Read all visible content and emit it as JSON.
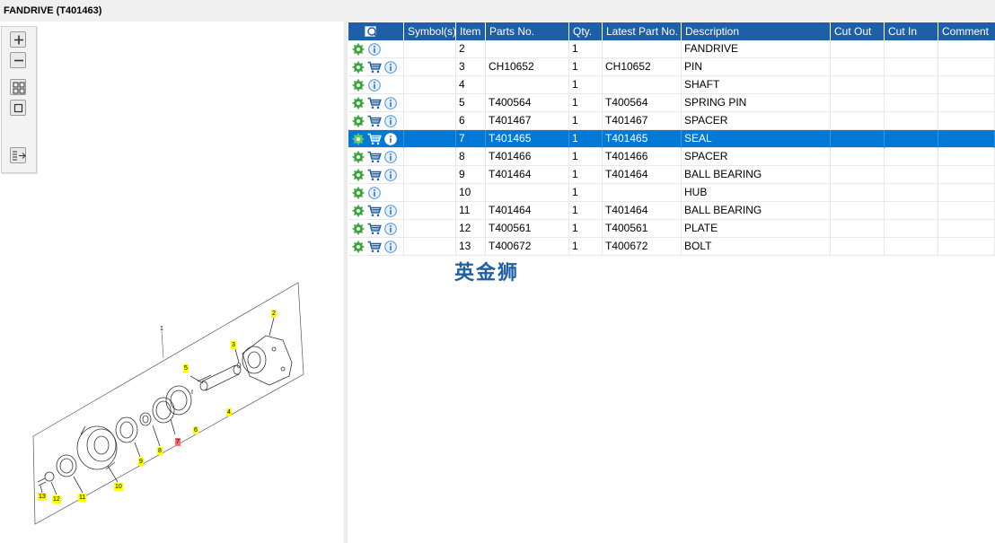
{
  "window": {
    "title": "FANDRIVE (T401463)"
  },
  "toolbar": {
    "buttons": [
      {
        "name": "zoom-in",
        "icon": "plus-icon"
      },
      {
        "name": "zoom-out",
        "icon": "minus-icon"
      },
      {
        "name": "fit-all",
        "icon": "fit-all-icon"
      },
      {
        "name": "fit-window",
        "icon": "fit-window-icon"
      },
      {
        "name": "export",
        "icon": "export-icon"
      }
    ]
  },
  "diagram": {
    "callouts": [
      {
        "label": "1",
        "style": "plain"
      },
      {
        "label": "2",
        "style": "yellow"
      },
      {
        "label": "3",
        "style": "yellow"
      },
      {
        "label": "4",
        "style": "yellow"
      },
      {
        "label": "5",
        "style": "yellow"
      },
      {
        "label": "6",
        "style": "yellow"
      },
      {
        "label": "7",
        "style": "red"
      },
      {
        "label": "8",
        "style": "yellow"
      },
      {
        "label": "9",
        "style": "yellow"
      },
      {
        "label": "10",
        "style": "yellow"
      },
      {
        "label": "11",
        "style": "yellow"
      },
      {
        "label": "12",
        "style": "yellow"
      },
      {
        "label": "13",
        "style": "yellow"
      }
    ]
  },
  "grid": {
    "header_icon": "search-icon",
    "columns": [
      "Symbol(s)",
      "Item",
      "Parts No.",
      "Qty.",
      "Latest Part No.",
      "Description",
      "Cut Out",
      "Cut In",
      "Comment"
    ],
    "rows": [
      {
        "item": "2",
        "parts_no": "",
        "qty": "1",
        "latest": "",
        "desc": "FANDRIVE",
        "cart": false,
        "selected": false
      },
      {
        "item": "3",
        "parts_no": "CH10652",
        "qty": "1",
        "latest": "CH10652",
        "desc": "PIN",
        "cart": true,
        "selected": false
      },
      {
        "item": "4",
        "parts_no": "",
        "qty": "1",
        "latest": "",
        "desc": "SHAFT",
        "cart": false,
        "selected": false
      },
      {
        "item": "5",
        "parts_no": "T400564",
        "qty": "1",
        "latest": "T400564",
        "desc": "SPRING PIN",
        "cart": true,
        "selected": false
      },
      {
        "item": "6",
        "parts_no": "T401467",
        "qty": "1",
        "latest": "T401467",
        "desc": "SPACER",
        "cart": true,
        "selected": false
      },
      {
        "item": "7",
        "parts_no": "T401465",
        "qty": "1",
        "latest": "T401465",
        "desc": "SEAL",
        "cart": true,
        "selected": true
      },
      {
        "item": "8",
        "parts_no": "T401466",
        "qty": "1",
        "latest": "T401466",
        "desc": "SPACER",
        "cart": true,
        "selected": false
      },
      {
        "item": "9",
        "parts_no": "T401464",
        "qty": "1",
        "latest": "T401464",
        "desc": "BALL BEARING",
        "cart": true,
        "selected": false
      },
      {
        "item": "10",
        "parts_no": "",
        "qty": "1",
        "latest": "",
        "desc": "HUB",
        "cart": false,
        "selected": false
      },
      {
        "item": "11",
        "parts_no": "T401464",
        "qty": "1",
        "latest": "T401464",
        "desc": "BALL BEARING",
        "cart": true,
        "selected": false
      },
      {
        "item": "12",
        "parts_no": "T400561",
        "qty": "1",
        "latest": "T400561",
        "desc": "PLATE",
        "cart": true,
        "selected": false
      },
      {
        "item": "13",
        "parts_no": "T400672",
        "qty": "1",
        "latest": "T400672",
        "desc": "BOLT",
        "cart": true,
        "selected": false
      }
    ]
  },
  "watermark": "英金狮",
  "colors": {
    "header_bg": "#1e5fa8",
    "selected_bg": "#0078d7",
    "gear_green": "#3aa53a",
    "cart_blue": "#1e5fa8",
    "info_blue": "#4a90d9",
    "callout_yellow": "#ffff00",
    "callout_red": "#ff6b6b"
  }
}
